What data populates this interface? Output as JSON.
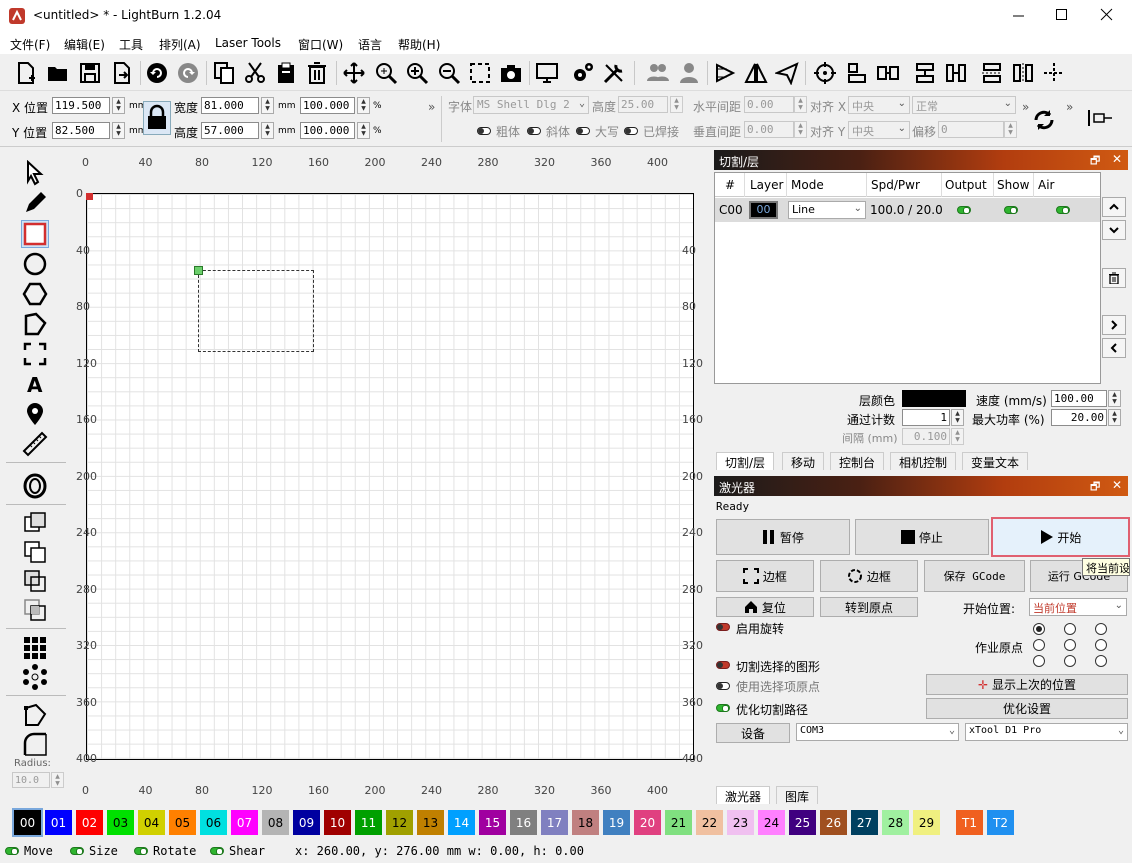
{
  "window": {
    "title": "<untitled> * - LightBurn 1.2.04"
  },
  "menu": [
    "文件(F)",
    "编辑(E)",
    "工具",
    "排列(A)",
    "Laser Tools",
    "窗口(W)",
    "语言",
    "帮助(H)"
  ],
  "props": {
    "x_label": "X 位置",
    "x_value": "119.500",
    "y_label": "Y 位置",
    "y_value": "82.500",
    "unit": "mm",
    "width_label": "宽度",
    "width_value": "81.000",
    "height_label": "高度",
    "height_value": "57.000",
    "scale_w": "100.000",
    "scale_h": "100.000",
    "pct": "%",
    "font_label": "字体",
    "font_value": "MS Shell Dlg 2",
    "fheight_label": "高度",
    "fheight_value": "25.00",
    "hspace_label": "水平间距",
    "hspace_value": "0.00",
    "vspace_label": "垂直间距",
    "vspace_value": "0.00",
    "align_x_label": "对齐 X",
    "align_x_value": "中央",
    "align_y_label": "对齐 Y",
    "align_y_value": "中央",
    "normal_value": "正常",
    "offset_label": "偏移",
    "offset_value": "0",
    "bold": "粗体",
    "italic": "斜体",
    "upper": "大写",
    "welded": "已焊接"
  },
  "ruler": {
    "top": [
      "0",
      "40",
      "80",
      "120",
      "160",
      "200",
      "240",
      "280",
      "320",
      "360",
      "400"
    ],
    "left": [
      "0",
      "40",
      "80",
      "120",
      "160",
      "200",
      "240",
      "280",
      "320",
      "360",
      "400"
    ],
    "right": [
      "40",
      "80",
      "120",
      "160",
      "200",
      "240",
      "280",
      "320",
      "360",
      "400"
    ]
  },
  "cuts": {
    "title": "切割/层",
    "headers": [
      "#",
      "Layer",
      "Mode",
      "Spd/Pwr",
      "Output",
      "Show",
      "Air"
    ],
    "row": {
      "id": "C00",
      "layer": "00",
      "mode": "Line",
      "spdpwr": "100.0 / 20.0"
    },
    "layer_color_label": "层颜色",
    "speed_label": "速度 (mm/s)",
    "speed_value": "100.00",
    "passes_label": "通过计数",
    "passes_value": "1",
    "maxpower_label": "最大功率 (%)",
    "maxpower_value": "20.00",
    "interval_label": "间隔 (mm)",
    "interval_value": "0.100",
    "tabs": [
      "切割/层",
      "移动",
      "控制台",
      "相机控制",
      "变量文本"
    ]
  },
  "laser": {
    "title": "激光器",
    "status": "Ready",
    "pause": "暂停",
    "stop": "停止",
    "start": "开始",
    "tooltip": "将当前设",
    "frame1": "边框",
    "frame2": "边框",
    "save_gcode": "保存 GCode",
    "run_gcode": "运行 GCode",
    "home": "复位",
    "goto_origin": "转到原点",
    "start_from_label": "开始位置:",
    "start_from_value": "当前位置",
    "rotary": "启用旋转",
    "job_origin": "作业原点",
    "cut_selected": "切割选择的图形",
    "use_selection_origin": "使用选择项原点",
    "show_last": "显示上次的位置",
    "optimize": "优化切割路径",
    "optimize_settings": "优化设置",
    "devices": "设备",
    "port": "COM3",
    "device": "xTool D1 Pro",
    "tabs": [
      "激光器",
      "图库"
    ]
  },
  "radius": {
    "label": "Radius:",
    "value": "10.0"
  },
  "palette": [
    {
      "label": "00",
      "color": "#000000",
      "text": "#ffffff"
    },
    {
      "label": "01",
      "color": "#0000ff",
      "text": "#ffffff"
    },
    {
      "label": "02",
      "color": "#ff0000",
      "text": "#ffffff"
    },
    {
      "label": "03",
      "color": "#00e000",
      "text": "#000000"
    },
    {
      "label": "04",
      "color": "#d0d000",
      "text": "#000000"
    },
    {
      "label": "05",
      "color": "#ff8000",
      "text": "#000000"
    },
    {
      "label": "06",
      "color": "#00e0e0",
      "text": "#000000"
    },
    {
      "label": "07",
      "color": "#ff00ff",
      "text": "#ffffff"
    },
    {
      "label": "08",
      "color": "#b4b4b4",
      "text": "#000000"
    },
    {
      "label": "09",
      "color": "#0000a0",
      "text": "#ffffff"
    },
    {
      "label": "10",
      "color": "#a00000",
      "text": "#ffffff"
    },
    {
      "label": "11",
      "color": "#00a000",
      "text": "#ffffff"
    },
    {
      "label": "12",
      "color": "#a0a000",
      "text": "#000000"
    },
    {
      "label": "13",
      "color": "#c08000",
      "text": "#000000"
    },
    {
      "label": "14",
      "color": "#00a0ff",
      "text": "#ffffff"
    },
    {
      "label": "15",
      "color": "#a000a0",
      "text": "#ffffff"
    },
    {
      "label": "16",
      "color": "#808080",
      "text": "#ffffff"
    },
    {
      "label": "17",
      "color": "#8080c0",
      "text": "#ffffff"
    },
    {
      "label": "18",
      "color": "#c08080",
      "text": "#000000"
    },
    {
      "label": "19",
      "color": "#4080c0",
      "text": "#ffffff"
    },
    {
      "label": "20",
      "color": "#e04080",
      "text": "#ffffff"
    },
    {
      "label": "21",
      "color": "#80e080",
      "text": "#000000"
    },
    {
      "label": "22",
      "color": "#f0c0a0",
      "text": "#000000"
    },
    {
      "label": "23",
      "color": "#f0c0f0",
      "text": "#000000"
    },
    {
      "label": "24",
      "color": "#ff80ff",
      "text": "#000000"
    },
    {
      "label": "25",
      "color": "#400080",
      "text": "#ffffff"
    },
    {
      "label": "26",
      "color": "#a05020",
      "text": "#ffffff"
    },
    {
      "label": "27",
      "color": "#004060",
      "text": "#ffffff"
    },
    {
      "label": "28",
      "color": "#a0f0a0",
      "text": "#000000"
    },
    {
      "label": "29",
      "color": "#f0f080",
      "text": "#000000"
    },
    {
      "label": "T1",
      "color": "#f06020",
      "text": "#ffffff"
    },
    {
      "label": "T2",
      "color": "#2090f0",
      "text": "#ffffff"
    }
  ],
  "status": {
    "move": "Move",
    "size": "Size",
    "rotate": "Rotate",
    "shear": "Shear",
    "coords": "x: 260.00, y: 276.00 mm  w: 0.00,  h: 0.00"
  }
}
